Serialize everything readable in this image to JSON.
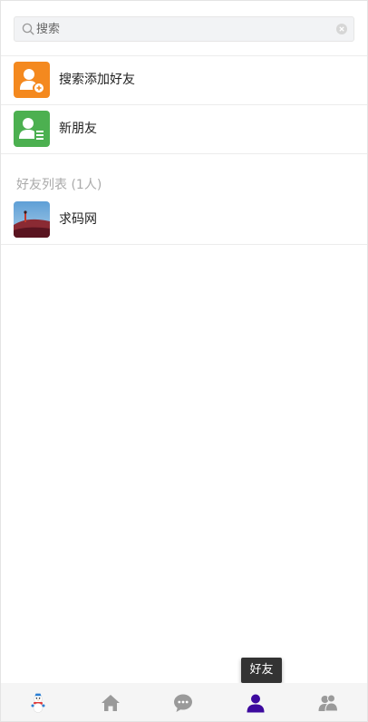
{
  "search": {
    "placeholder": "搜索",
    "value": ""
  },
  "contacts": {
    "add_friend_label": "搜索添加好友",
    "new_friends_label": "新朋友",
    "section_title": "好友列表 (1人)",
    "friends": [
      {
        "name": "求码网"
      }
    ]
  },
  "tooltip": {
    "text": "好友"
  },
  "tabbar": {
    "tabs": [
      {
        "icon": "snowman-avatar-icon",
        "active": false
      },
      {
        "icon": "home-icon",
        "active": false
      },
      {
        "icon": "chat-bubble-icon",
        "active": false
      },
      {
        "icon": "person-icon",
        "active": true
      },
      {
        "icon": "group-icon",
        "active": false
      }
    ]
  },
  "colors": {
    "add_friend_bg": "#f4891f",
    "new_friends_bg": "#4cb050",
    "active_tab": "#3d0a9e",
    "inactive_tab": "#9a9a9a"
  }
}
